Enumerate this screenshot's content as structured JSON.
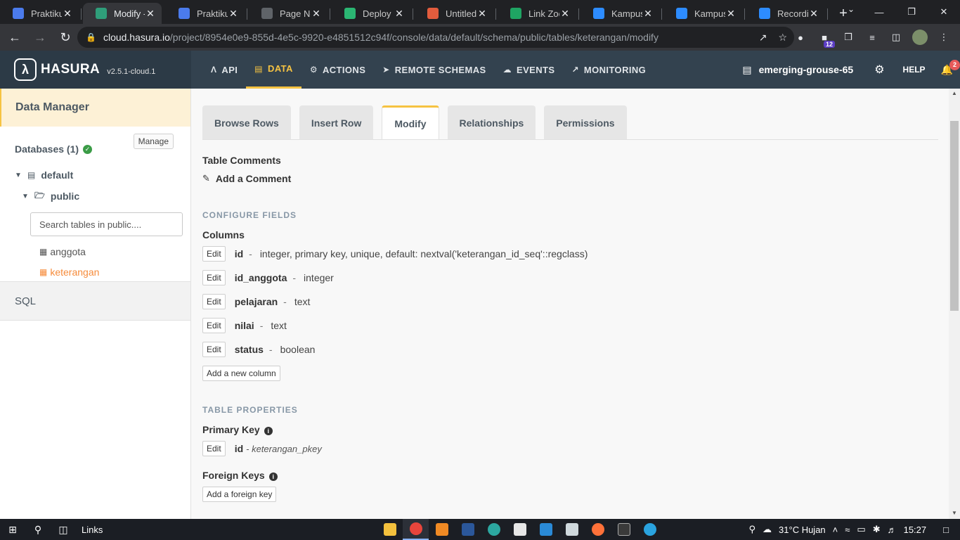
{
  "browser": {
    "tabs": [
      {
        "label": "Praktikum",
        "icon": "chart-icon",
        "color": "#4b7bec",
        "active": false
      },
      {
        "label": "Modify - Hasura",
        "icon": "hasura-icon",
        "color": "#2f9e7a",
        "active": true
      },
      {
        "label": "Praktikum",
        "icon": "chart-icon",
        "color": "#4b7bec",
        "active": false
      },
      {
        "label": "Page Not Found",
        "icon": "globe-icon",
        "color": "#5f6368",
        "active": false
      },
      {
        "label": "Deploy on Railway",
        "icon": "diamond-icon",
        "color": "#2bb673",
        "active": false
      },
      {
        "label": "Untitled",
        "icon": "figma-icon",
        "color": "#e25c3d",
        "active": false
      },
      {
        "label": "Link Zoom",
        "icon": "sheets-icon",
        "color": "#1fa463",
        "active": false
      },
      {
        "label": "Kampus",
        "icon": "zoom-icon",
        "color": "#2d8cff",
        "active": false
      },
      {
        "label": "Kampus",
        "icon": "zoom-icon",
        "color": "#2d8cff",
        "active": false
      },
      {
        "label": "Recording",
        "icon": "zoom-icon",
        "color": "#2d8cff",
        "active": false
      }
    ],
    "url_host": "cloud.hasura.io",
    "url_path": "/project/8954e0e9-855d-4e5c-9920-e4851512c94f/console/data/default/schema/public/tables/keterangan/modify",
    "extension_badge": "12"
  },
  "hasura": {
    "brand": "HASURA",
    "version": "v2.5.1-cloud.1",
    "nav": [
      {
        "label": "API",
        "icon": "flask-icon",
        "active": false
      },
      {
        "label": "DATA",
        "icon": "database-icon",
        "active": true
      },
      {
        "label": "ACTIONS",
        "icon": "cogs-icon",
        "active": false
      },
      {
        "label": "REMOTE SCHEMAS",
        "icon": "plug-icon",
        "active": false
      },
      {
        "label": "EVENTS",
        "icon": "cloud-icon",
        "active": false
      },
      {
        "label": "MONITORING",
        "icon": "chart-line-icon",
        "active": false
      }
    ],
    "project": "emerging-grouse-65",
    "help": "HELP",
    "notifications": "2",
    "accent": "#f6c342"
  },
  "sidebar": {
    "title": "Data Manager",
    "databases_label": "Databases (1)",
    "manage": "Manage",
    "db_name": "default",
    "schema_name": "public",
    "search_placeholder": "Search tables in public....",
    "tables": [
      {
        "name": "anggota",
        "active": false
      },
      {
        "name": "keterangan",
        "active": true
      }
    ],
    "sql": "SQL"
  },
  "main": {
    "tabs": [
      {
        "label": "Browse Rows",
        "active": false
      },
      {
        "label": "Insert Row",
        "active": false
      },
      {
        "label": "Modify",
        "active": true
      },
      {
        "label": "Relationships",
        "active": false
      },
      {
        "label": "Permissions",
        "active": false
      }
    ],
    "table_comments_label": "Table Comments",
    "add_comment": "Add a Comment",
    "configure_fields": "CONFIGURE FIELDS",
    "columns_label": "Columns",
    "edit_label": "Edit",
    "columns": [
      {
        "name": "id",
        "desc": "integer, primary key, unique, default: nextval('keterangan_id_seq'::regclass)"
      },
      {
        "name": "id_anggota",
        "desc": "integer"
      },
      {
        "name": "pelajaran",
        "desc": "text"
      },
      {
        "name": "nilai",
        "desc": "text"
      },
      {
        "name": "status",
        "desc": "boolean"
      }
    ],
    "add_column": "Add a new column",
    "table_properties": "TABLE PROPERTIES",
    "primary_key_label": "Primary Key",
    "pk_column": "id",
    "pk_name": "keterangan_pkey",
    "foreign_keys_label": "Foreign Keys",
    "add_foreign_key": "Add a foreign key"
  },
  "taskbar": {
    "links": "Links",
    "weather": "31°C  Hujan",
    "time": "15:27"
  }
}
